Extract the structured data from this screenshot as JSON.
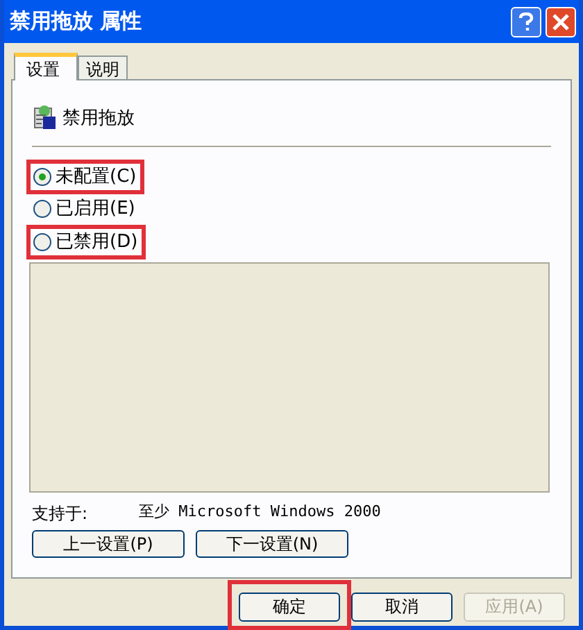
{
  "window": {
    "title": "禁用拖放 属性"
  },
  "tabs": [
    {
      "label": "设置",
      "selected": true
    },
    {
      "label": "说明",
      "selected": false
    }
  ],
  "setting": {
    "name": "禁用拖放"
  },
  "options": [
    {
      "label": "未配置(C)",
      "selected": true,
      "highlighted": true
    },
    {
      "label": "已启用(E)",
      "selected": false,
      "highlighted": false
    },
    {
      "label": "已禁用(D)",
      "selected": false,
      "highlighted": true
    }
  ],
  "supported": {
    "label": "支持于:",
    "value": "至少 Microsoft Windows 2000"
  },
  "nav_buttons": [
    "上一设置(P)",
    "下一设置(N)"
  ],
  "buttons": [
    {
      "label": "确定",
      "disabled": false,
      "highlighted": true
    },
    {
      "label": "取消",
      "disabled": false,
      "highlighted": false
    },
    {
      "label": "应用(A)",
      "disabled": true,
      "highlighted": false
    }
  ]
}
